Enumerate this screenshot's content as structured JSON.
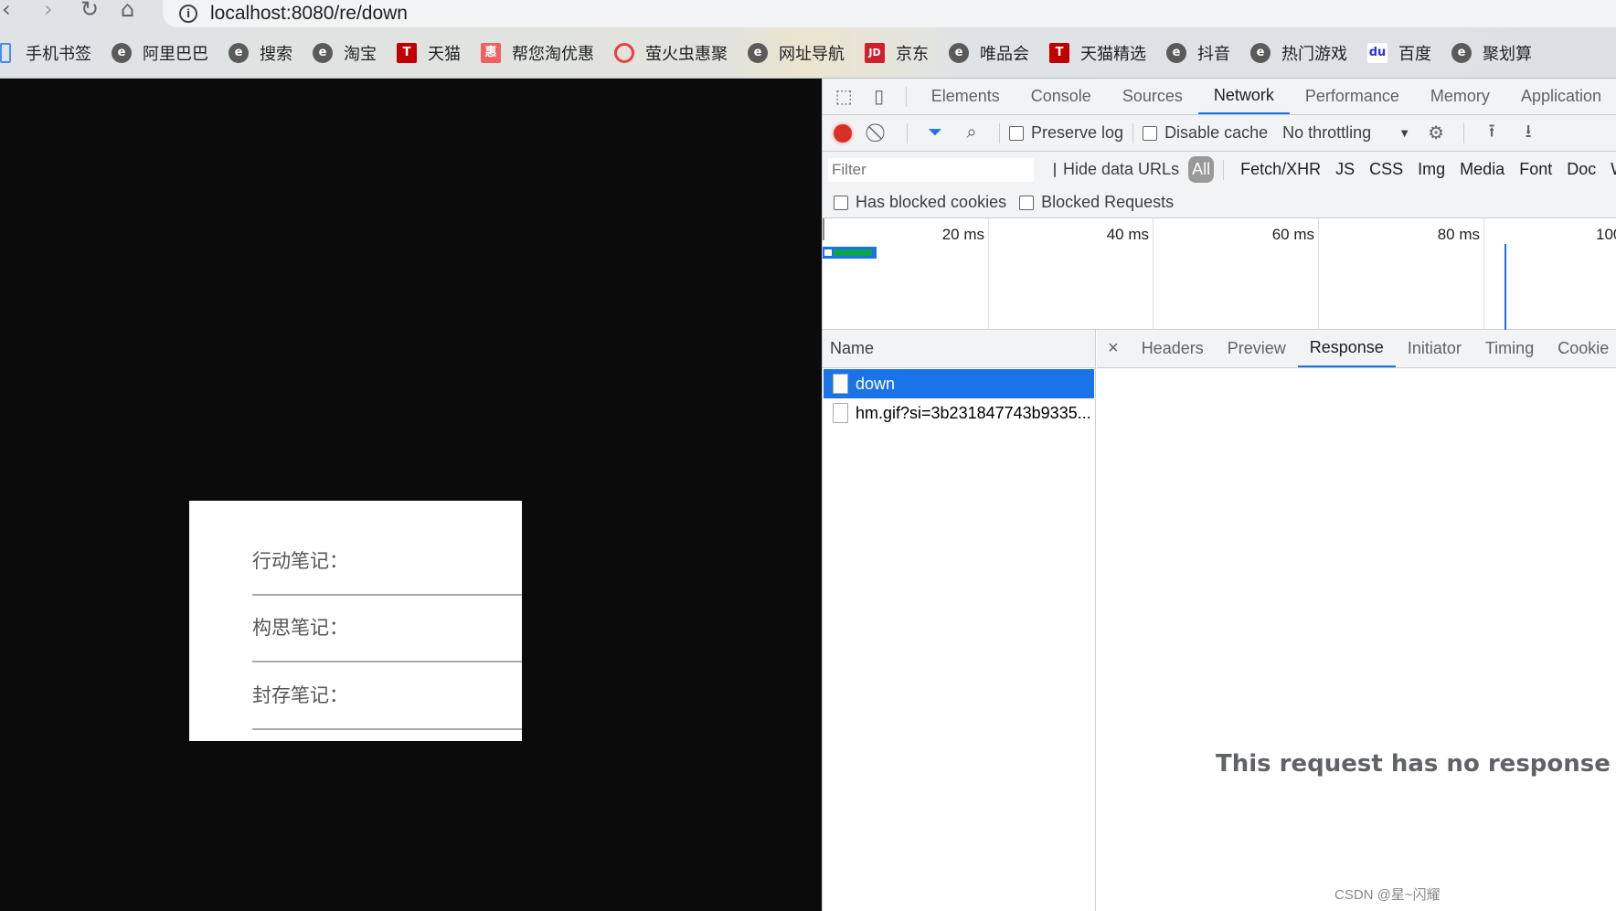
{
  "browser": {
    "url": "localhost:8080/re/down",
    "nav": {
      "back": "‹",
      "forward": "›",
      "reload": "↻",
      "home": "⌂"
    },
    "bookmarks": [
      {
        "label": "手机书签",
        "icon": "bookmark-folder-icon",
        "color": "#4a8af4"
      },
      {
        "label": "阿里巴巴",
        "icon": "e-icon",
        "color": "#5a5a5a"
      },
      {
        "label": "搜索",
        "icon": "e-icon",
        "color": "#5a5a5a"
      },
      {
        "label": "淘宝",
        "icon": "e-icon",
        "color": "#5a5a5a"
      },
      {
        "label": "天猫",
        "icon": "tmall-icon",
        "color": "#c00000",
        "glyph": "T"
      },
      {
        "label": "帮您淘优惠",
        "icon": "hui-icon",
        "color": "#f06060",
        "glyph": "惠"
      },
      {
        "label": "萤火虫惠聚",
        "icon": "firefly-icon",
        "color": "#e94040",
        "glyph": "○"
      },
      {
        "label": "网址导航",
        "icon": "e-icon",
        "color": "#5a5a5a"
      },
      {
        "label": "京东",
        "icon": "jd-icon",
        "color": "#d0202e",
        "glyph": "JD"
      },
      {
        "label": "唯品会",
        "icon": "e-icon",
        "color": "#5a5a5a"
      },
      {
        "label": "天猫精选",
        "icon": "tmall-icon",
        "color": "#c00000",
        "glyph": "T"
      },
      {
        "label": "抖音",
        "icon": "e-icon",
        "color": "#5a5a5a"
      },
      {
        "label": "热门游戏",
        "icon": "e-icon",
        "color": "#5a5a5a"
      },
      {
        "label": "百度",
        "icon": "baidu-icon",
        "color": "#2932e1",
        "glyph": "du"
      },
      {
        "label": "聚划算",
        "icon": "e-icon",
        "color": "#5a5a5a"
      }
    ]
  },
  "page": {
    "notes": [
      "行动笔记：",
      "构思笔记：",
      "封存笔记："
    ]
  },
  "devtools": {
    "tabs": [
      "Elements",
      "Console",
      "Sources",
      "Network",
      "Performance",
      "Memory",
      "Application"
    ],
    "active_tab": "Network",
    "toolbar": {
      "preserve_log": "Preserve log",
      "disable_cache": "Disable cache",
      "throttling": "No throttling"
    },
    "filter": {
      "placeholder": "Filter",
      "hide_data_urls": "Hide data URLs",
      "types": [
        "All",
        "Fetch/XHR",
        "JS",
        "CSS",
        "Img",
        "Media",
        "Font",
        "Doc",
        "W"
      ]
    },
    "blocked": {
      "cookies": "Has blocked cookies",
      "requests": "Blocked Requests"
    },
    "timeline": {
      "ticks": [
        "20 ms",
        "40 ms",
        "60 ms",
        "80 ms",
        "100"
      ]
    },
    "requests": {
      "header": "Name",
      "rows": [
        {
          "name": "down",
          "selected": true
        },
        {
          "name": "hm.gif?si=3b231847743b9335..."
        }
      ]
    },
    "detail_tabs": [
      "Headers",
      "Preview",
      "Response",
      "Initiator",
      "Timing",
      "Cookie"
    ],
    "detail_active": "Response",
    "close": "×",
    "no_response": "This request has no response d"
  },
  "watermark": "CSDN @星~闪耀",
  "colors": {
    "accent": "#1a73e8",
    "record": "#d93025",
    "selected_row": "#1a73e8"
  }
}
